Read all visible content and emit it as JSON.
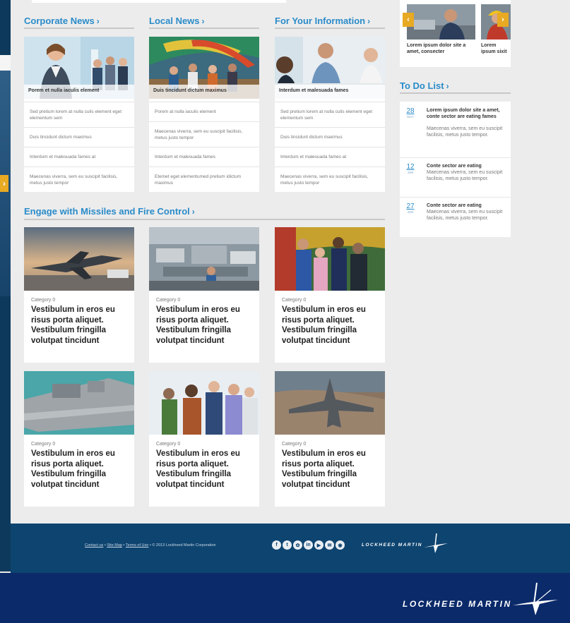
{
  "sections": {
    "corporate_news": "Corporate News",
    "local_news": "Local News",
    "fyi": "For Your Information",
    "engage": "Engage with Missiles and Fire Control",
    "todo": "To Do List",
    "chevron": "›"
  },
  "news_columns": [
    {
      "caption": "Porem et nulla iaculis element",
      "items": [
        "Sed pretium lorem at nulla culis element eget elementum sem",
        "Duis tincidunt dictum maximus",
        "Interdum et malesuada fames at",
        "Maecenas viverra, sem eu suscipit facilisis, metus justo tempor"
      ]
    },
    {
      "caption": "Duis tincidunt dictum maximus",
      "items": [
        "Porem at nulla iaculis element",
        "Maecenas viverra, sem eu suscipit facilisis, metus justo tempor",
        "Interdum et malesuada fames",
        "Etemet eget elementumed pretium idictum maximus"
      ]
    },
    {
      "caption": "Interdum et malesuada fames",
      "items": [
        "Sed pretium lorem at nulla culis element eget elementum sem",
        "Duis tincidunt dictum maximus",
        "Interdum et malesuada fames at",
        "Maecenas viverra, sem eu suscipit facilisis, metus justo tempor"
      ]
    }
  ],
  "engage_cards": [
    {
      "category": "Category 0",
      "title": "Vestibulum in eros eu risus porta aliquet. Vestibulum fringilla volutpat tincidunt"
    },
    {
      "category": "Category 0",
      "title": "Vestibulum in eros eu risus porta aliquet. Vestibulum fringilla volutpat tincidunt"
    },
    {
      "category": "Category 0",
      "title": "Vestibulum in eros eu risus porta aliquet. Vestibulum fringilla volutpat tincidunt"
    },
    {
      "category": "Category 0",
      "title": "Vestibulum in eros eu risus porta aliquet. Vestibulum fringilla volutpat tincidunt"
    },
    {
      "category": "Category 0",
      "title": "Vestibulum in eros eu risus porta aliquet. Vestibulum fringilla volutpat tincidunt"
    },
    {
      "category": "Category 0",
      "title": "Vestibulum in eros eu risus porta aliquet. Vestibulum fringilla volutpat tincidunt"
    }
  ],
  "carousel": {
    "items": [
      "Lorem ipsum dolor site a amet, consecter",
      "Lorem ipsum sixit amet"
    ],
    "prev": "‹",
    "next": "›"
  },
  "todo_items": [
    {
      "day": "28",
      "month": "MAY",
      "head": "Lorem ipsum dolor site a amet, conte sector are eating fames",
      "body": "Maecenas viverra, sem eu suscipit facilisis, metus justo tempor."
    },
    {
      "day": "12",
      "month": "JUN",
      "head": "Conte sector are eating",
      "body": "Maecenas viverra, sem eu suscipit facilisis, metus justo tempor."
    },
    {
      "day": "27",
      "month": "JUN",
      "head": "Conte sector are eating",
      "body": "Maecenas viverra, sem eu suscipit facilisis, metus justo tempor."
    }
  ],
  "footer": {
    "contact": "Contact us",
    "sitemap": "Site Map",
    "terms": "Terms of Use",
    "copyright": "© 2013 Lockheed Martin Corporation",
    "sep": "•",
    "social_icons": [
      "facebook-icon",
      "twitter-icon",
      "flickr-icon",
      "linkedin-icon",
      "youtube-icon",
      "email-icon",
      "rss-icon"
    ],
    "social_glyphs": [
      "f",
      "t",
      "✿",
      "in",
      "▶",
      "✉",
      "◉"
    ],
    "logo": "LOCKHEED MARTIN"
  },
  "bottom_logo": "LOCKHEED MARTIN",
  "colors": {
    "accent": "#2a8bc9",
    "footer": "#0e4470",
    "bottom": "#0b2a6a",
    "carousel_btn": "#e8a923"
  },
  "left_arrow": "›"
}
